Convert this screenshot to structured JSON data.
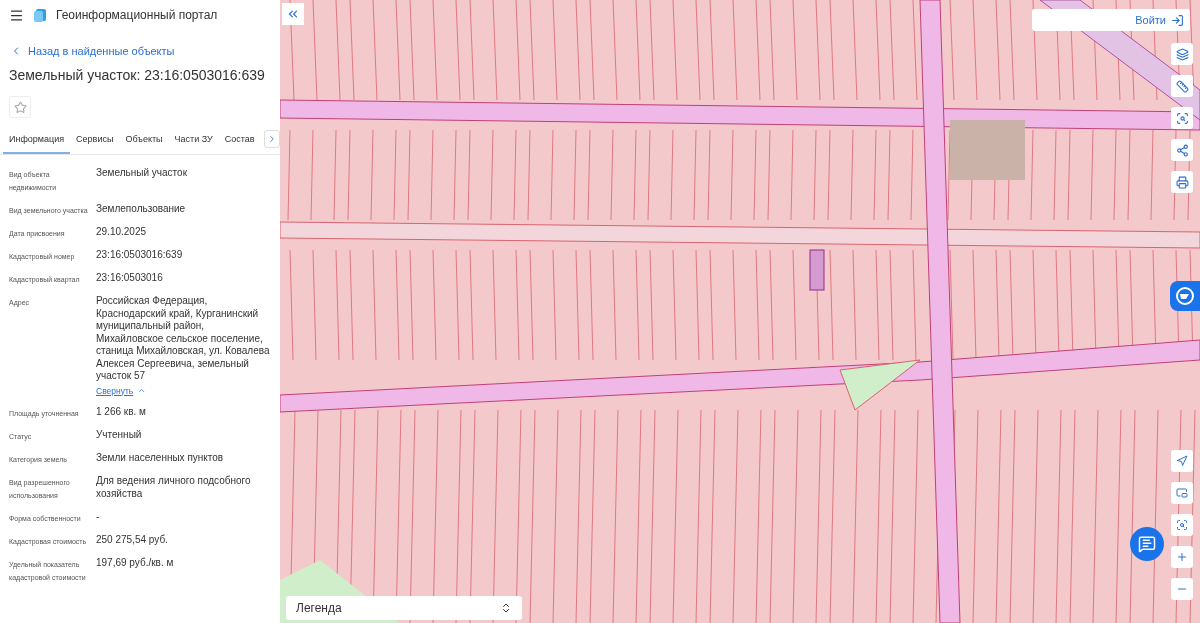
{
  "header": {
    "title": "Геоинформационный портал"
  },
  "back_link": "Назад в найденные объекты",
  "object_title": "Земельный участок: 23:16:0503016:639",
  "favorite": {
    "on": false
  },
  "tabs": [
    {
      "label": "Информация",
      "selected": true
    },
    {
      "label": "Сервисы",
      "selected": false
    },
    {
      "label": "Объекты",
      "selected": false
    },
    {
      "label": "Части ЗУ",
      "selected": false
    },
    {
      "label": "Состав",
      "selected": false
    }
  ],
  "fields": [
    {
      "label": "Вид объекта недвижимости",
      "value": "Земельный участок"
    },
    {
      "label": "Вид земельного участка",
      "value": "Землепользование"
    },
    {
      "label": "Дата присвоения",
      "value": "29.10.2025"
    },
    {
      "label": "Кадастровый номер",
      "value": "23:16:0503016:639"
    },
    {
      "label": "Кадастровый квартал",
      "value": "23:16:0503016"
    },
    {
      "label": "Адрес",
      "value": "Российская Федерация, Краснодарский край, Курганинский муниципальный район, Михайловское сельское поселение, станица Михайловская, ул. Ковалева Алексея Сергеевича, земельный участок 57",
      "toggle": "Свернуть"
    },
    {
      "label": "Площадь уточненная",
      "value": "1 266 кв. м"
    },
    {
      "label": "Статус",
      "value": "Учтенный"
    },
    {
      "label": "Категория земель",
      "value": "Земли населенных пунктов"
    },
    {
      "label": "Вид разрешенного использования",
      "value": "Для ведения личного подсобного хозяйства"
    },
    {
      "label": "Форма собственности",
      "value": "-"
    },
    {
      "label": "Кадастровая стоимость",
      "value": "250 275,54 руб."
    },
    {
      "label": "Удельный показатель кадастровой стоимости",
      "value": "197,69 руб./кв. м"
    }
  ],
  "map": {
    "login": "Войти",
    "legend": "Легенда"
  }
}
